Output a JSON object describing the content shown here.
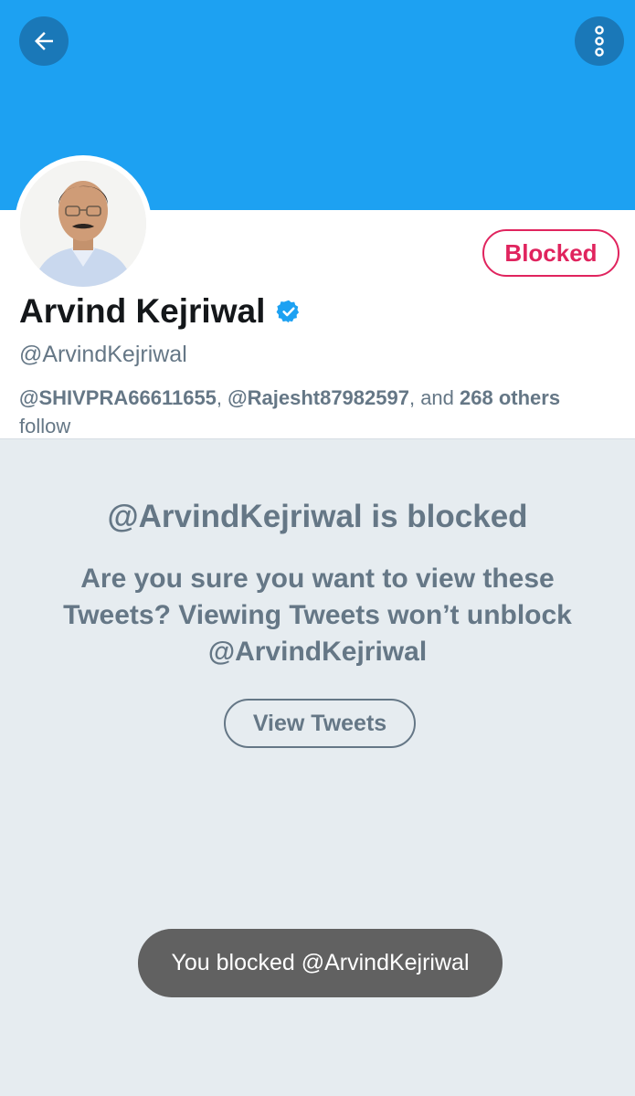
{
  "header": {
    "back_icon": "arrow-left-icon",
    "more_icon": "vertical-ellipsis-icon"
  },
  "profile": {
    "name": "Arvind Kejriwal",
    "verified_icon": "verified-badge-icon",
    "handle": "@ArvindKejriwal",
    "follow_button": "Blocked",
    "followers": {
      "user1": "@SHIVPRA66611655",
      "sep1": ", ",
      "user2": "@Rajesht87982597",
      "sep2": ", and ",
      "others": "268 others",
      "suffix": " follow"
    }
  },
  "blocked_notice": {
    "title": "@ArvindKejriwal is blocked",
    "message": "Are you sure you want to view these Tweets? Viewing Tweets won’t unblock @ArvindKejriwal",
    "view_button": "View Tweets"
  },
  "toast": {
    "text": "You blocked @ArvindKejriwal"
  },
  "colors": {
    "banner": "#1da1f2",
    "blocked": "#e0245e",
    "verified": "#1da1f2",
    "muted_text": "#657786"
  }
}
